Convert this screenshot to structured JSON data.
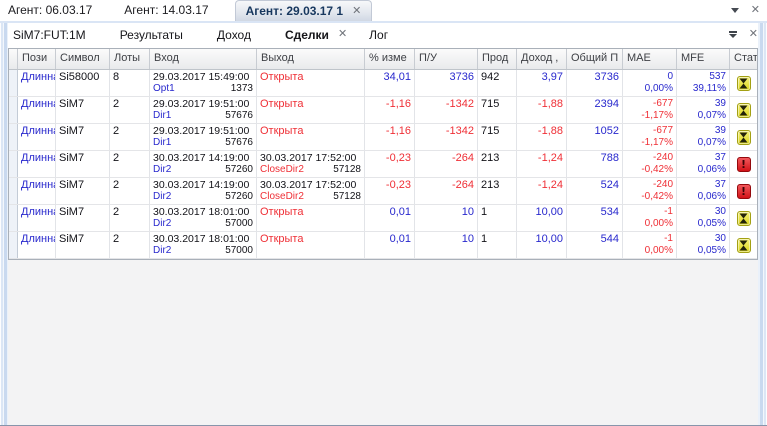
{
  "colors": {
    "positive": "#2828cd",
    "negative": "#ef2f36",
    "neutral": "#121218",
    "open_status": "#ef2f36",
    "hourglass_bg": "#e8e23a",
    "warning_bg": "#e02a30"
  },
  "top_tabbar": {
    "tabs": [
      {
        "label": "Агент: 06.03.17"
      },
      {
        "label": "Агент: 14.03.17"
      },
      {
        "label": "Агент: 29.03.17 1",
        "close": "✕"
      }
    ],
    "menu_icon": "caret-down-icon",
    "close_icon": "✕"
  },
  "sub_tabbar": {
    "tabs": [
      {
        "label": "SiM7:FUT:1M"
      },
      {
        "label": "Результаты"
      },
      {
        "label": "Доход"
      },
      {
        "label": "Сделки",
        "close": "✕",
        "active": true
      },
      {
        "label": "Лог"
      }
    ],
    "overflow_icon": "tab-overflow-icon",
    "close_icon": "✕"
  },
  "trades_table": {
    "columns": [
      "",
      "Пози",
      "Символ",
      "Лоты",
      "Вход",
      "Выход",
      "% изме",
      "П/У",
      "Прод",
      "Доход ,",
      "Общий П",
      "MAE",
      "MFE",
      "Стат"
    ],
    "rows": [
      {
        "position": "Длинная",
        "symbol": "Si58000",
        "lots": "8",
        "entry": {
          "datetime": "29.03.2017 15:49:00",
          "signal": "Opt1",
          "price": "1373"
        },
        "exit": {
          "open": true,
          "label": "Открыта"
        },
        "pct_change": "34,01",
        "pl": "3736",
        "duration": "942",
        "income": "3,97",
        "total_pl": "3736",
        "mae": {
          "value": "0",
          "pct": "0,00%",
          "negative": false
        },
        "mfe": {
          "value": "537",
          "pct": "39,11%"
        },
        "status": "hourglass"
      },
      {
        "position": "Длинная",
        "symbol": "SiM7",
        "lots": "2",
        "entry": {
          "datetime": "29.03.2017 19:51:00",
          "signal": "Dir1",
          "price": "57676"
        },
        "exit": {
          "open": true,
          "label": "Открыта"
        },
        "pct_change": "-1,16",
        "pl": "-1342",
        "duration": "715",
        "income": "-1,88",
        "total_pl": "2394",
        "mae": {
          "value": "-677",
          "pct": "-1,17%",
          "negative": true
        },
        "mfe": {
          "value": "39",
          "pct": "0,07%"
        },
        "status": "hourglass"
      },
      {
        "position": "Длинная",
        "symbol": "SiM7",
        "lots": "2",
        "entry": {
          "datetime": "29.03.2017 19:51:00",
          "signal": "Dir1",
          "price": "57676"
        },
        "exit": {
          "open": true,
          "label": "Открыта"
        },
        "pct_change": "-1,16",
        "pl": "-1342",
        "duration": "715",
        "income": "-1,88",
        "total_pl": "1052",
        "mae": {
          "value": "-677",
          "pct": "-1,17%",
          "negative": true
        },
        "mfe": {
          "value": "39",
          "pct": "0,07%"
        },
        "status": "hourglass"
      },
      {
        "position": "Длинная",
        "symbol": "SiM7",
        "lots": "2",
        "entry": {
          "datetime": "30.03.2017 14:19:00",
          "signal": "Dir2",
          "price": "57260"
        },
        "exit": {
          "open": false,
          "datetime": "30.03.2017 17:52:00",
          "signal": "CloseDir2",
          "price": "57128"
        },
        "pct_change": "-0,23",
        "pl": "-264",
        "duration": "213",
        "income": "-1,24",
        "total_pl": "788",
        "mae": {
          "value": "-240",
          "pct": "-0,42%",
          "negative": true
        },
        "mfe": {
          "value": "37",
          "pct": "0,06%"
        },
        "status": "warning"
      },
      {
        "position": "Длинная",
        "symbol": "SiM7",
        "lots": "2",
        "entry": {
          "datetime": "30.03.2017 14:19:00",
          "signal": "Dir2",
          "price": "57260"
        },
        "exit": {
          "open": false,
          "datetime": "30.03.2017 17:52:00",
          "signal": "CloseDir2",
          "price": "57128"
        },
        "pct_change": "-0,23",
        "pl": "-264",
        "duration": "213",
        "income": "-1,24",
        "total_pl": "524",
        "mae": {
          "value": "-240",
          "pct": "-0,42%",
          "negative": true
        },
        "mfe": {
          "value": "37",
          "pct": "0,06%"
        },
        "status": "warning"
      },
      {
        "position": "Длинная",
        "symbol": "SiM7",
        "lots": "2",
        "entry": {
          "datetime": "30.03.2017 18:01:00",
          "signal": "Dir2",
          "price": "57000"
        },
        "exit": {
          "open": true,
          "label": "Открыта"
        },
        "pct_change": "0,01",
        "pl": "10",
        "duration": "1",
        "income": "10,00",
        "total_pl": "534",
        "mae": {
          "value": "-1",
          "pct": "0,00%",
          "negative": true
        },
        "mfe": {
          "value": "30",
          "pct": "0,05%"
        },
        "status": "hourglass"
      },
      {
        "position": "Длинная",
        "symbol": "SiM7",
        "lots": "2",
        "entry": {
          "datetime": "30.03.2017 18:01:00",
          "signal": "Dir2",
          "price": "57000"
        },
        "exit": {
          "open": true,
          "label": "Открыта"
        },
        "pct_change": "0,01",
        "pl": "10",
        "duration": "1",
        "income": "10,00",
        "total_pl": "544",
        "mae": {
          "value": "-1",
          "pct": "0,00%",
          "negative": true
        },
        "mfe": {
          "value": "30",
          "pct": "0,05%"
        },
        "status": "hourglass"
      }
    ]
  }
}
